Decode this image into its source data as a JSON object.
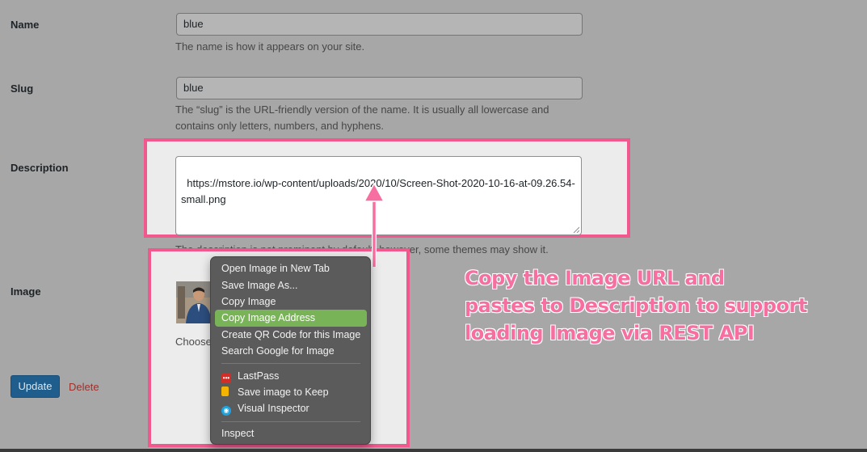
{
  "form": {
    "name": {
      "label": "Name",
      "value": "blue",
      "help": "The name is how it appears on your site."
    },
    "slug": {
      "label": "Slug",
      "value": "blue",
      "help_line1": "The “slug” is the URL-friendly version of the name. It is usually all lowercase and",
      "help_line2": "contains only letters, numbers, and hyphens."
    },
    "description": {
      "label": "Description",
      "value": "https://mstore.io/wp-content/uploads/2020/10/Screen-Shot-2020-10-16-at-09.26.54-small.png",
      "help": "The description is not prominent by default; however, some themes may show it."
    },
    "image": {
      "label": "Image",
      "choose_text": "Choose"
    },
    "update_button": "Update",
    "delete_link": "Delete"
  },
  "context_menu": {
    "items": [
      {
        "label": "Open Image in New Tab"
      },
      {
        "label": "Save Image As..."
      },
      {
        "label": "Copy Image"
      },
      {
        "label": "Copy Image Address",
        "highlighted": true
      },
      {
        "label": "Create QR Code for this Image"
      },
      {
        "label": "Search Google for Image"
      },
      {
        "label": "LastPass",
        "icon": "lastpass-icon"
      },
      {
        "label": "Save image to Keep",
        "icon": "keep-icon"
      },
      {
        "label": "Visual Inspector",
        "icon": "visual-inspector-icon"
      },
      {
        "label": "Inspect"
      }
    ]
  },
  "annotation": {
    "line1": "Copy the Image URL and",
    "line2": "pastes to Description to support",
    "line3": "loading Image via REST API"
  },
  "colors": {
    "highlight_border": "#f0588e",
    "annotation_text": "#f76fa0",
    "menu_active": "#79b358",
    "update_button": "#1f5d8c",
    "delete_link": "#a0302b"
  }
}
